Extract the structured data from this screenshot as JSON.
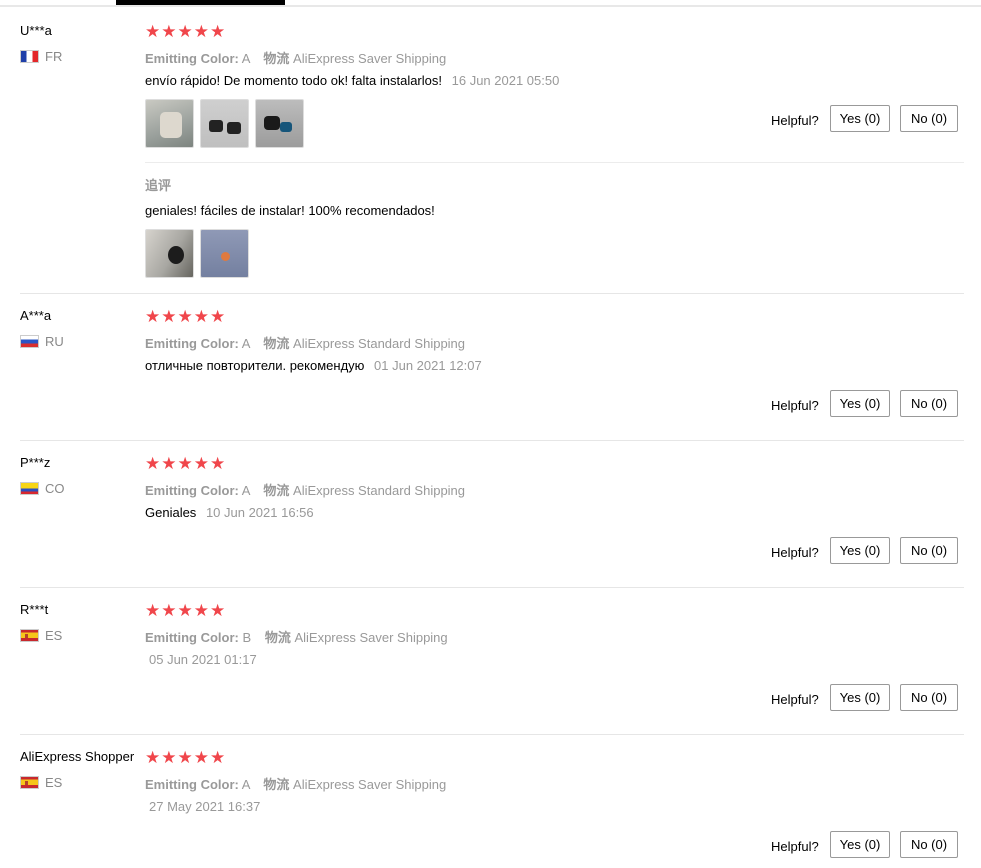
{
  "header": {
    "active_tab": ""
  },
  "labels": {
    "helpful": "Helpful?",
    "sku_key": "Emitting Color:",
    "shipping_key": "物流",
    "append_review": "追评"
  },
  "icons": {
    "star": "star-icon"
  },
  "colors": {
    "star": "#f0464b",
    "muted": "#999999"
  },
  "reviews": [
    {
      "name": "U***a",
      "country": "FR",
      "rating": 5,
      "color_value": "A",
      "shipping": "AliExpress Saver Shipping",
      "text": "envío rápido! De momento todo ok! falta instalarlos!",
      "date": "16 Jun 2021 05:50",
      "yes": "Yes (0)",
      "no": "No (0)",
      "photos": 3,
      "append_text": "geniales! fáciles de instalar! 100% recomendados!",
      "append_photos": 2
    },
    {
      "name": "A***a",
      "country": "RU",
      "rating": 5,
      "color_value": "A",
      "shipping": "AliExpress Standard Shipping",
      "text": "отличные повторители. рекомендую",
      "date": "01 Jun 2021 12:07",
      "yes": "Yes (0)",
      "no": "No (0)"
    },
    {
      "name": "P***z",
      "country": "CO",
      "rating": 5,
      "color_value": "A",
      "shipping": "AliExpress Standard Shipping",
      "text": "Geniales",
      "date": "10 Jun 2021 16:56",
      "yes": "Yes (0)",
      "no": "No (0)"
    },
    {
      "name": "R***t",
      "country": "ES",
      "rating": 5,
      "color_value": "B",
      "shipping": "AliExpress Saver Shipping",
      "text": "",
      "date": "05 Jun 2021 01:17",
      "yes": "Yes (0)",
      "no": "No (0)"
    },
    {
      "name": "AliExpress Shopper",
      "country": "ES",
      "rating": 5,
      "color_value": "A",
      "shipping": "AliExpress Saver Shipping",
      "text": "",
      "date": "27 May 2021 16:37",
      "yes": "Yes (0)",
      "no": "No (0)"
    }
  ]
}
